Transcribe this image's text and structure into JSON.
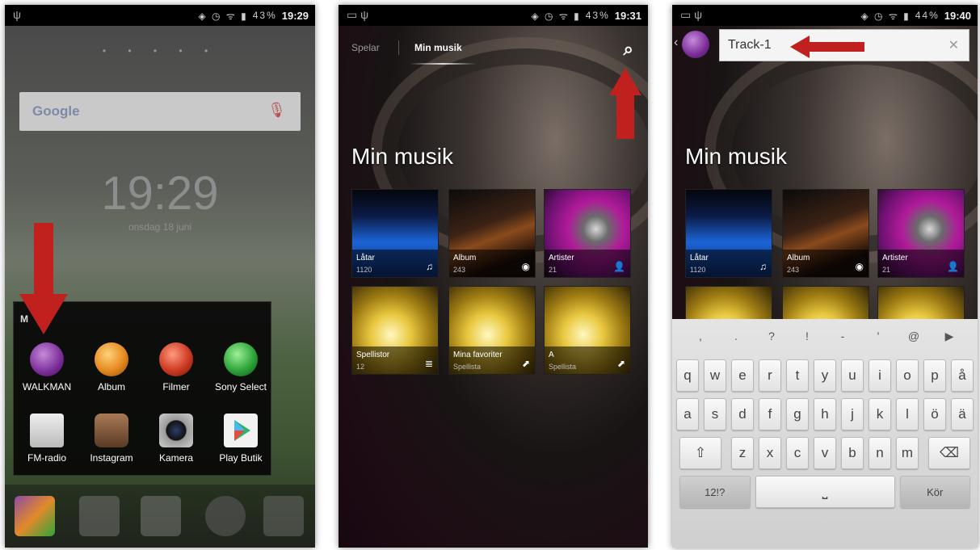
{
  "phone1": {
    "status_time": "19:29",
    "status_battery": "43%",
    "search_logo": "Google",
    "clock": "19:29",
    "date": "onsdag 18 juni",
    "folder_title": "M",
    "apps": [
      {
        "label": "WALKMAN",
        "icon": "walkman-icon",
        "color": "#8b3aa8"
      },
      {
        "label": "Album",
        "icon": "album-icon",
        "color": "#e6891f"
      },
      {
        "label": "Filmer",
        "icon": "movies-icon",
        "color": "#cc3a22"
      },
      {
        "label": "Sony Select",
        "icon": "sony-select-icon",
        "color": "#2ea43a"
      },
      {
        "label": "FM-radio",
        "icon": "radio-icon",
        "color": "#cfcfcf"
      },
      {
        "label": "Instagram",
        "icon": "instagram-icon",
        "color": "#7a5236"
      },
      {
        "label": "Kamera",
        "icon": "camera-icon",
        "color": "#888"
      },
      {
        "label": "Play Butik",
        "icon": "play-store-icon",
        "color": "#f2f2f2"
      }
    ]
  },
  "phone2": {
    "status_time": "19:31",
    "status_battery": "43%",
    "tabs": [
      "Spelar",
      "Min musik"
    ],
    "heading": "Min musik",
    "tiles": [
      {
        "name": "Låtar",
        "count": "1120",
        "icon": "music-note-icon"
      },
      {
        "name": "Album",
        "count": "243",
        "icon": "disc-icon"
      },
      {
        "name": "Artister",
        "count": "21",
        "icon": "person-icon"
      },
      {
        "name": "Spellistor",
        "count": "12",
        "icon": "playlist-icon"
      },
      {
        "name": "Mina favoriter",
        "count": "Spellista",
        "icon": "pin-icon"
      },
      {
        "name": "A",
        "count": "Spellista",
        "icon": "pin-icon"
      }
    ]
  },
  "phone3": {
    "status_time": "19:40",
    "status_battery": "44%",
    "search_value": "Track-1",
    "heading": "Min musik",
    "tiles": [
      {
        "name": "Låtar",
        "count": "1120"
      },
      {
        "name": "Album",
        "count": "243"
      },
      {
        "name": "Artister",
        "count": "21"
      }
    ],
    "keyboard": {
      "symbols": [
        ",",
        ".",
        "?",
        "!",
        "-",
        "'",
        "@",
        "▶"
      ],
      "row1": [
        "q",
        "w",
        "e",
        "r",
        "t",
        "y",
        "u",
        "i",
        "o",
        "p",
        "å"
      ],
      "row2": [
        "a",
        "s",
        "d",
        "f",
        "g",
        "h",
        "j",
        "k",
        "l",
        "ö",
        "ä"
      ],
      "row3": [
        "z",
        "x",
        "c",
        "v",
        "b",
        "n",
        "m"
      ],
      "shift": "⇧",
      "backspace": "⌫",
      "numbers_key": "12!?",
      "space_key": "⎵",
      "enter_key": "Kör"
    }
  },
  "colors": {
    "arrow": "#c0201e"
  }
}
